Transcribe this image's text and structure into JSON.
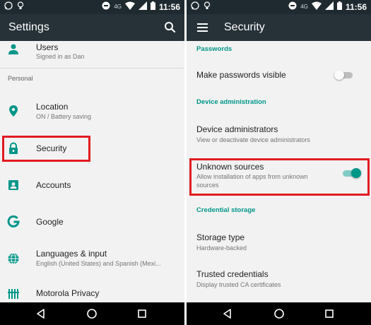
{
  "status_bar": {
    "network_label": "4G",
    "time": "11:56"
  },
  "left_screen": {
    "title": "Settings",
    "users": {
      "title": "Users",
      "subtitle": "Signed in as Dan"
    },
    "section_personal": "Personal",
    "location": {
      "title": "Location",
      "subtitle": "ON / Battery saving"
    },
    "security": {
      "title": "Security"
    },
    "accounts": {
      "title": "Accounts"
    },
    "google": {
      "title": "Google"
    },
    "languages": {
      "title": "Languages & input",
      "subtitle": "English (United States) and Spanish (Mexi..."
    },
    "motorola": {
      "title": "Motorola Privacy"
    }
  },
  "right_screen": {
    "title": "Security",
    "section_passwords": "Passwords",
    "make_passwords_visible": {
      "title": "Make passwords visible",
      "toggle_on": false
    },
    "section_device_admin": "Device administration",
    "device_administrators": {
      "title": "Device administrators",
      "subtitle": "View or deactivate device administrators"
    },
    "unknown_sources": {
      "title": "Unknown sources",
      "subtitle_line1": "Allow installation of apps from unknown",
      "subtitle_line2": "sources",
      "toggle_on": true
    },
    "section_credential_storage": "Credential storage",
    "storage_type": {
      "title": "Storage type",
      "subtitle": "Hardware-backed"
    },
    "trusted_credentials": {
      "title": "Trusted credentials",
      "subtitle": "Display trusted CA certificates"
    }
  },
  "icons": {
    "status": [
      "whatsapp-icon",
      "bulb-icon",
      "do-not-disturb-icon",
      "wifi-icon",
      "signal-icon",
      "battery-icon"
    ],
    "appbar": [
      "search-icon",
      "menu-icon"
    ],
    "rows": [
      "person-icon",
      "location-pin-icon",
      "lock-icon",
      "accounts-icon",
      "google-icon",
      "globe-icon",
      "motorola-privacy-icon"
    ],
    "nav": [
      "back-icon",
      "home-icon",
      "recents-icon"
    ]
  },
  "colors": {
    "app_bar": "#263238",
    "status_bar": "#1f2a30",
    "accent": "#009688",
    "highlight": "#e11b22",
    "background": "#f2f2f2"
  }
}
